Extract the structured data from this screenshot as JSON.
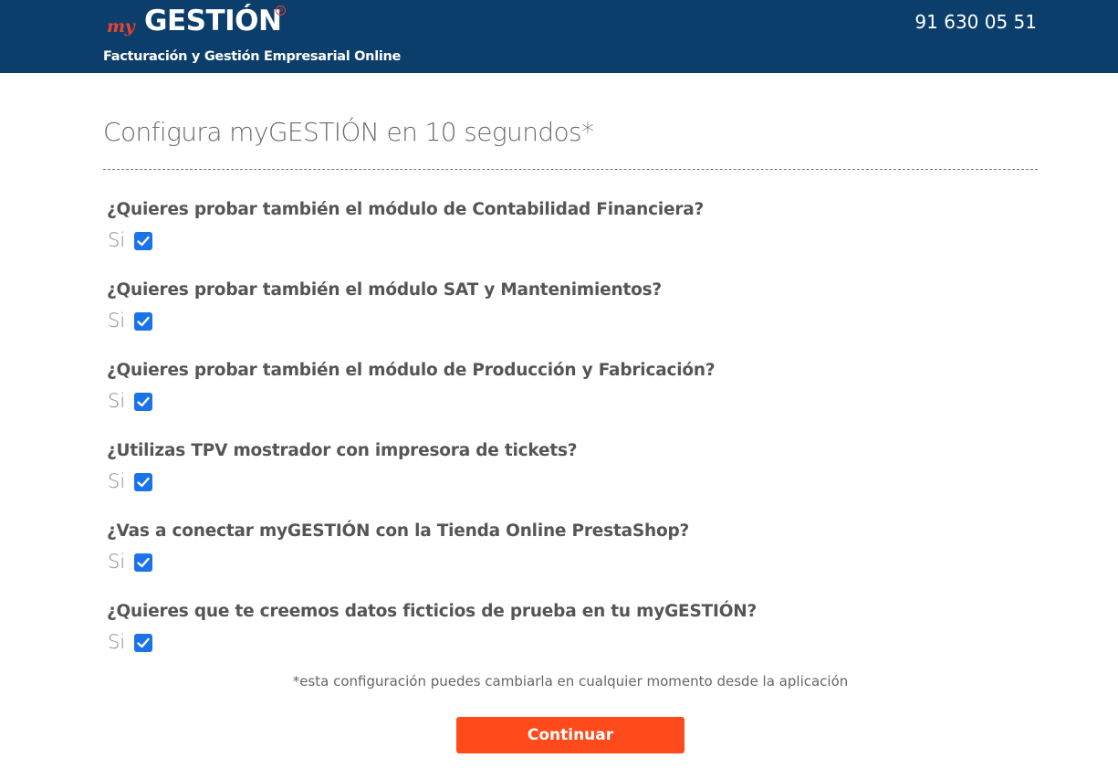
{
  "header": {
    "logo_my": "my",
    "logo_gestion": "GESTIÓN",
    "logo_reg": "®",
    "tagline": "Facturación y Gestión Empresarial Online",
    "phone": "91 630 05 51"
  },
  "main": {
    "title": "Configura myGESTIÓN en 10 segundos*",
    "questions": [
      {
        "label": "¿Quieres probar también el módulo de Contabilidad Financiera?",
        "answer": "Si",
        "checked": true
      },
      {
        "label": "¿Quieres probar también el módulo SAT y Mantenimientos?",
        "answer": "Si",
        "checked": true
      },
      {
        "label": "¿Quieres probar también el módulo de Producción y Fabricación?",
        "answer": "Si",
        "checked": true
      },
      {
        "label": "¿Utilizas TPV mostrador con impresora de tickets?",
        "answer": "Si",
        "checked": true
      },
      {
        "label": "¿Vas a conectar myGESTIÓN con la Tienda Online PrestaShop?",
        "answer": "Si",
        "checked": true
      },
      {
        "label": "¿Quieres que te creemos datos ficticios de prueba en tu myGESTIÓN?",
        "answer": "Si",
        "checked": true
      }
    ],
    "footnote": "*esta configuración puedes cambiarla en cualquier momento desde la aplicación",
    "continue_label": "Continuar"
  },
  "colors": {
    "header_bg": "#0c3e6b",
    "brand_accent": "#e8442e",
    "checkbox": "#1a73e8",
    "button": "#ff4a1c"
  }
}
